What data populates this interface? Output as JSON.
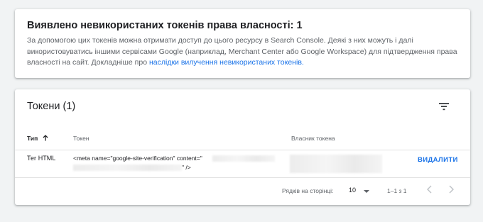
{
  "info": {
    "title": "Виявлено невикористаних токенів права власності: 1",
    "text": "За допомогою цих токенів можна отримати доступ до цього ресурсу в Search Console. Деякі з них можуть і далі використовуватись іншими сервісами Google (наприклад, Merchant Center або Google Workspace) для підтвердження права власності на сайт. Докладніше про",
    "link": "наслідки вилучення невикористаних токенів."
  },
  "tokens": {
    "title": "Токени (1)",
    "filter_icon": "filter-icon",
    "columns": {
      "type": "Тип",
      "token": "Токен",
      "owner": "Власник токена"
    },
    "sort_icon": "arrow-up-icon",
    "rows": [
      {
        "type": "Тег HTML",
        "token_line1": "<meta name=\"google-site-verification\" content=\"",
        "token_line2": "\" />",
        "action": "ВИДАЛИТИ"
      }
    ]
  },
  "pagination": {
    "rows_label": "Рядків на сторінці:",
    "rows_value": "10",
    "range": "1–1 з 1",
    "prev_icon": "chevron-left-icon",
    "next_icon": "chevron-right-icon"
  },
  "colors": {
    "accent": "#1a73e8",
    "background": "#f1f3f4",
    "card": "#ffffff",
    "muted": "#5f6368"
  }
}
